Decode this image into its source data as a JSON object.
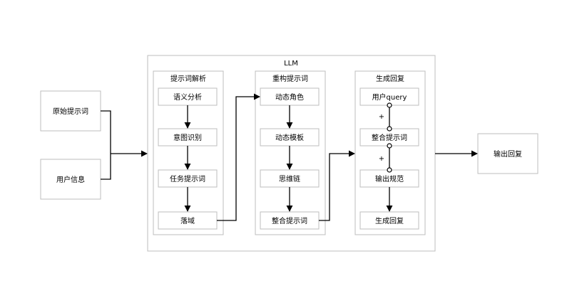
{
  "inputs": {
    "prompt": "原始提示词",
    "user_info": "用户信息"
  },
  "llm": {
    "title": "LLM"
  },
  "parse": {
    "title": "提示词解析",
    "steps": [
      "语义分析",
      "意图识别",
      "任务提示词",
      "落域"
    ]
  },
  "rebuild": {
    "title": "重构提示词",
    "steps": [
      "动态角色",
      "动态模板",
      "思维链",
      "整合提示词"
    ]
  },
  "generate": {
    "title": "生成回复",
    "steps": [
      "用户query",
      "整合提示词",
      "输出规范",
      "生成回复"
    ],
    "plus": "+"
  },
  "output": {
    "label": "输出回复"
  }
}
